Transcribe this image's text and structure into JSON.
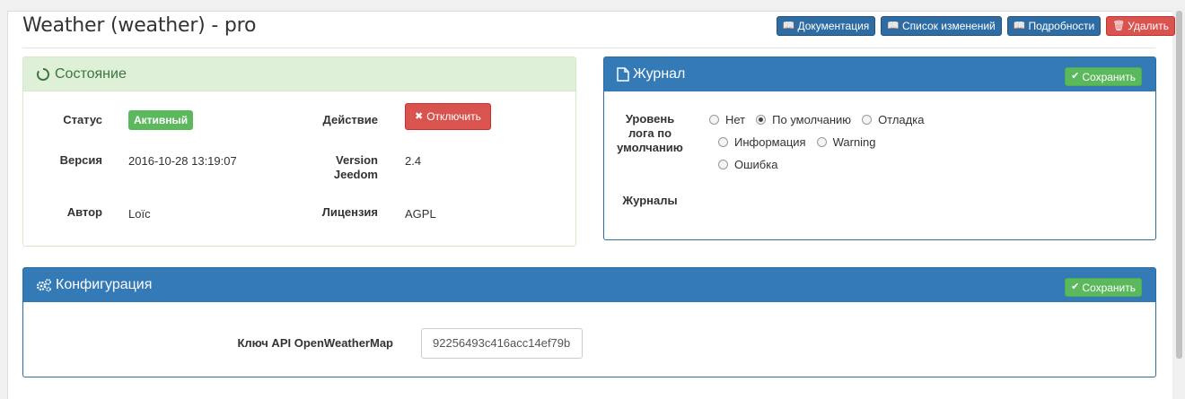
{
  "page_title": "Weather (weather) - pro",
  "top_buttons": {
    "docs": "Документация",
    "changelog": "Список изменений",
    "details": "Подробности",
    "delete": "Удалить"
  },
  "state_panel": {
    "title": "Состояние",
    "status_label": "Статус",
    "status_value": "Активный",
    "action_label": "Действие",
    "action_button": "Отключить",
    "version_label": "Версия",
    "version_value": "2016-10-28 13:19:07",
    "jeedom_label_1": "Version",
    "jeedom_label_2": "Jeedom",
    "jeedom_value": "2.4",
    "author_label": "Автор",
    "author_value": "Loïc",
    "license_label": "Лицензия",
    "license_value": "AGPL"
  },
  "log_panel": {
    "title": "Журнал",
    "save": "Сохранить",
    "level_label_1": "Уровень",
    "level_label_2": "лога по",
    "level_label_3": "умолчанию",
    "options": [
      "Нет",
      "По умолчанию",
      "Отладка",
      "Информация",
      "Warning",
      "Ошибка"
    ],
    "selected": "По умолчанию",
    "logs_label": "Журналы"
  },
  "config_panel": {
    "title": "Конфигурация",
    "save": "Сохранить",
    "api_label": "Ключ API OpenWeatherMap",
    "api_value": "92256493c416acc14ef79b"
  },
  "colors": {
    "primary": "#337ab7",
    "danger": "#d9534f",
    "success": "#5cb85c",
    "state_bg": "#dff0d8"
  }
}
